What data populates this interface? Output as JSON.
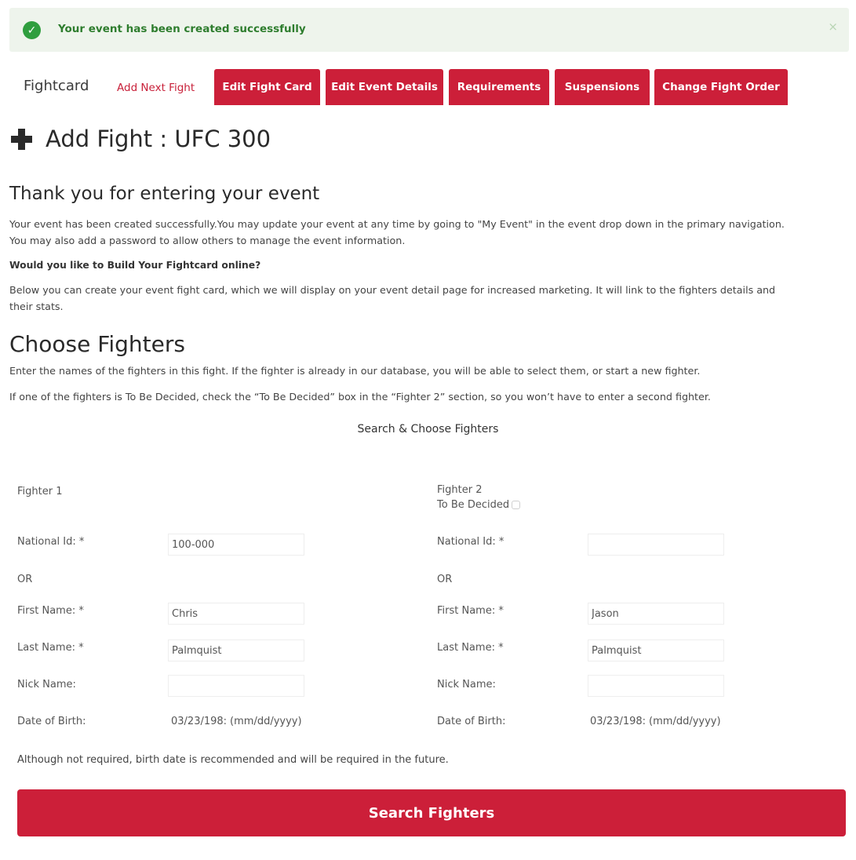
{
  "alert": {
    "message": "Your event has been created successfully",
    "close_glyph": "×",
    "check_glyph": "✓",
    "color": "#2f9e3e"
  },
  "tabs": {
    "title": "Fightcard",
    "active_link": "Add Next Fight",
    "buttons": [
      "Edit Fight Card",
      "Edit Event Details",
      "Requirements",
      "Suspensions",
      "Change Fight Order"
    ],
    "accent_color": "#cc1f39"
  },
  "page": {
    "heading": "Add Fight : UFC 300",
    "heading_icon": "plus-icon"
  },
  "intro": {
    "title": "Thank you for entering your event",
    "line1": "Your event has been created successfully.You may update your event at any time by going to \"My Event\" in the event drop down in the primary navigation.",
    "line2": "You may also add a password to allow others to manage the event information.",
    "question": "Would you like to Build Your Fightcard online?",
    "line3": "Below you can create your event fight card, which we will display on your event detail page for increased marketing. It will link to the fighters details and",
    "line4": "their stats."
  },
  "choose": {
    "title": "Choose Fighters",
    "line1": "Enter the names of the fighters in this fight. If the fighter is already in our database, you will be able to select them, or start a new fighter.",
    "line2": "If one of the fighters is To Be Decided, check the “To Be Decided” box in the “Fighter 2” section, so you won’t have to enter a second fighter.",
    "section_title": "Search & Choose Fighters"
  },
  "labels": {
    "national_id": "National Id: *",
    "or": "OR",
    "first_name": "First Name: *",
    "last_name": "Last Name: *",
    "nick_name": "Nick Name:",
    "dob": "Date of Birth:",
    "dob_hint": "(mm/dd/yyyy)"
  },
  "fighter1": {
    "title": "Fighter 1",
    "national_id": "100-000",
    "first_name": "Chris",
    "last_name": "Palmquist",
    "nick_name": "",
    "dob": "03/23/198:"
  },
  "fighter2": {
    "title": "Fighter 2",
    "tbd_label": "To Be Decided",
    "tbd_checked": false,
    "national_id": "",
    "first_name": "Jason",
    "last_name": "Palmquist",
    "nick_name": "",
    "dob": "03/23/198:"
  },
  "note": "Although not required, birth date is recommended and will be required in the future.",
  "search_button": "Search Fighters"
}
